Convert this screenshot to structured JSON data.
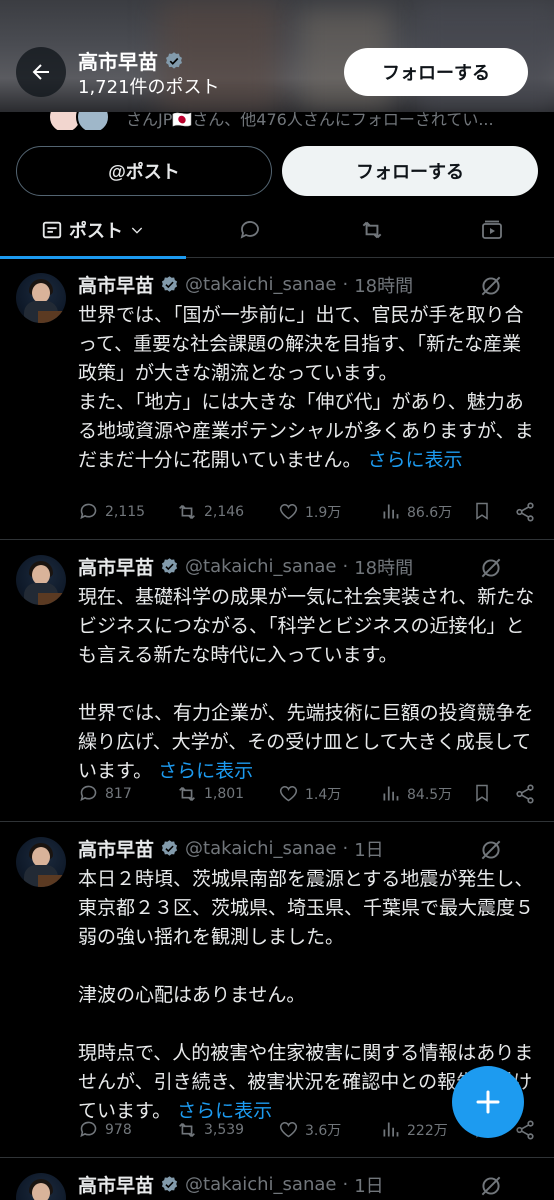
{
  "header": {
    "name": "高市早苗",
    "post_count": "1,721件のポスト",
    "follow_label": "フォローする"
  },
  "followers_text": "さんJP🇯🇵さん、他476人さんにフォローされてい...",
  "profile_actions": {
    "post_label": "@ポスト",
    "follow_label": "フォローする"
  },
  "tabs": {
    "posts_label": "ポスト"
  },
  "posts": [
    {
      "name": "高市早苗",
      "handle": "@takaichi_sanae",
      "time": "18時間",
      "text": "世界では、「国が一歩前に」出て、官民が手を取り合って、重要な社会課題の解決を目指す、「新たな産業政策」が大きな潮流となっています。\nまた、「地方」には大きな「伸び代」があり、魅力ある地域資源や産業ポテンシャルが多くありますが、まだまだ十分に花開いていません。",
      "more": "さらに表示",
      "replies": "2,115",
      "reposts": "2,146",
      "likes": "1.9万",
      "views": "86.6万"
    },
    {
      "name": "高市早苗",
      "handle": "@takaichi_sanae",
      "time": "18時間",
      "text": "現在、基礎科学の成果が一気に社会実装され、新たなビジネスにつながる、「科学とビジネスの近接化」とも言える新たな時代に入っています。\n\n世界では、有力企業が、先端技術に巨額の投資競争を繰り広げ、大学が、その受け皿として大きく成長しています。",
      "more": "さらに表示",
      "replies": "817",
      "reposts": "1,801",
      "likes": "1.4万",
      "views": "84.5万"
    },
    {
      "name": "高市早苗",
      "handle": "@takaichi_sanae",
      "time": "1日",
      "text": "本日２時頃、茨城県南部を震源とする地震が発生し、東京都２３区、茨城県、埼玉県、千葉県で最大震度５弱の強い揺れを観測しました。\n\n津波の心配はありません。\n\n現時点で、人的被害や住家被害に関する情報はありませんが、引き続き、被害状況を確認中との報告を受けています。",
      "more": "さらに表示",
      "replies": "978",
      "reposts": "3,539",
      "likes": "3.6万",
      "views": "222万"
    },
    {
      "name": "高市早苗",
      "handle": "@takaichi_sanae",
      "time": "1日"
    }
  ],
  "colors": {
    "accent": "#1d9bf0",
    "background": "#000000",
    "muted": "#71767b",
    "text": "#e7e9ea",
    "verified": "#829aab"
  }
}
